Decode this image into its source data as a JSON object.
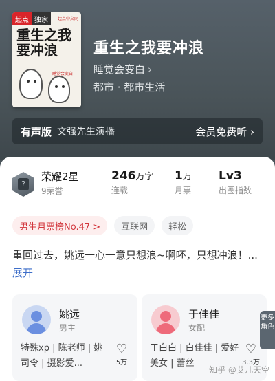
{
  "cover": {
    "badge_brand": "起点",
    "badge_exclusive": "独家",
    "title_text": "重生之我要冲浪",
    "publisher": "起点中文网",
    "stamp": "睡觉会变白 著"
  },
  "book": {
    "title": "重生之我要冲浪",
    "author": "睡觉会变白",
    "author_chevron": "›",
    "genre": "都市 · 都市生活"
  },
  "audio": {
    "label": "有声版",
    "narrator": "文强先生演播",
    "cta": "会员免费听 ›"
  },
  "stats": {
    "honor_title": "荣耀2星",
    "honor_sub": "9荣誉",
    "words_value": "246",
    "words_unit": "万字",
    "words_label": "连载",
    "tickets_value": "1",
    "tickets_unit": "万",
    "tickets_label": "月票",
    "level_value": "Lv3",
    "level_label": "出圈指数"
  },
  "chips": {
    "rank": "男生月票榜No.47 >",
    "tag1": "互联网",
    "tag2": "轻松"
  },
  "description": {
    "text": "重回过去，姚远一心一意只想浪~啊呸，只想冲浪！...",
    "more": "展开"
  },
  "roles": [
    {
      "name": "姚远",
      "role": "男主",
      "tags": "特殊xp | 陈老师 | 姚司令 | 摄影爱...",
      "likes": "5万"
    },
    {
      "name": "于佳佳",
      "role": "女配",
      "tags": "于白白 | 白佳佳 | 爱好美女 | 蕾丝",
      "likes": "3.3万"
    }
  ],
  "side_button": "更多角色",
  "watermark": "知乎 @艾儿天空",
  "colors": {
    "accent_red": "#d2363c",
    "link_blue": "#3d6ec9",
    "hero_bg": "#4a5459"
  }
}
